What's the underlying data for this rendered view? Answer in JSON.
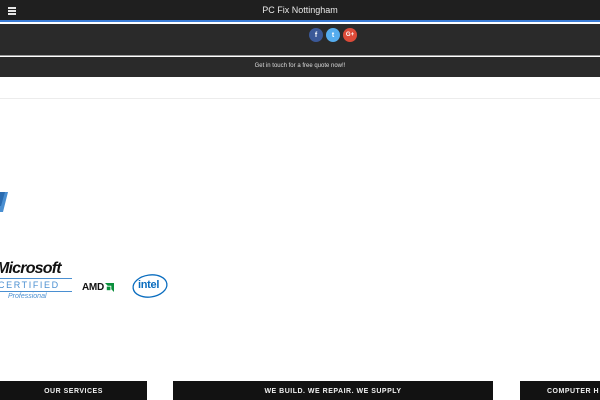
{
  "header": {
    "title": "PC Fix Nottingham",
    "menu_icon": "hamburger-menu-icon"
  },
  "social": {
    "items": [
      {
        "icon": "facebook-icon",
        "glyph": "f",
        "color": "#3b5998"
      },
      {
        "icon": "twitter-icon",
        "glyph": "t",
        "color": "#55acee"
      },
      {
        "icon": "google-plus-icon",
        "glyph": "G+",
        "color": "#dd4b39"
      }
    ]
  },
  "quote_bar": {
    "text": "Get in touch for a free quote now!!"
  },
  "logos": {
    "microsoft": {
      "word": "Microsoft",
      "certified": "CERTIFIED",
      "professional": "Professional"
    },
    "amd": {
      "word": "AMD"
    },
    "intel": {
      "word": "intel"
    }
  },
  "tiles": [
    {
      "label": "OUR SERVICES"
    },
    {
      "label": "WE BUILD. WE REPAIR. WE SUPPLY"
    },
    {
      "label": "COMPUTER H"
    }
  ],
  "colors": {
    "header_bg": "#1f1f1f",
    "accent_blue": "#3a7bd5",
    "tile_bg": "#121212"
  }
}
